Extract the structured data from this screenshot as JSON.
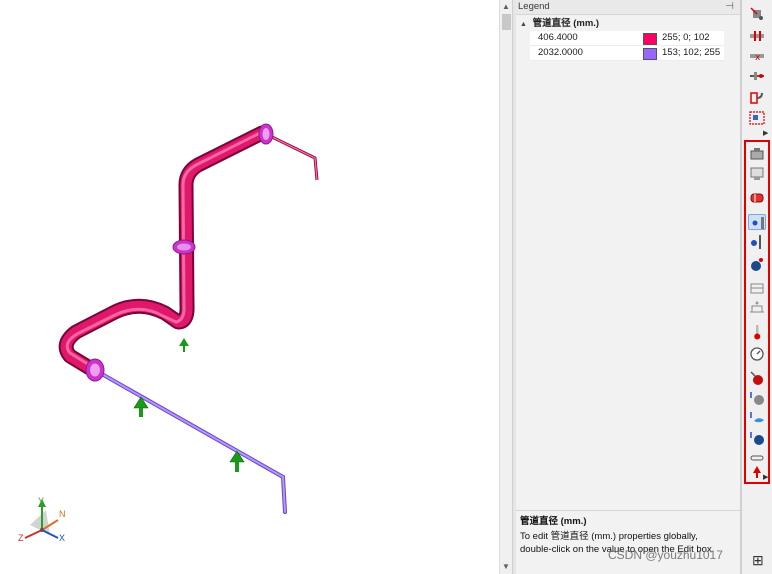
{
  "legend": {
    "panel_title": "Legend",
    "pin_icon": "pin-icon",
    "header": "管道直径 (mm.)",
    "rows": [
      {
        "value": "406.4000",
        "color": "#ff0066",
        "rgb_text": "255; 0; 102"
      },
      {
        "value": "2032.0000",
        "color": "#9966ff",
        "rgb_text": "153; 102; 255"
      }
    ],
    "description": {
      "title": "管道直径 (mm.)",
      "line1": "To edit 管道直径 (mm.) properties globally,",
      "line2": "double-click on the value to open the Edit box."
    }
  },
  "axes": {
    "y": "Y",
    "n": "N",
    "z": "Z",
    "x": "X"
  },
  "colors": {
    "pipe_large": "#e0186c",
    "pipe_small": "#9966ff",
    "restraint_arrow": "#1a9a1a",
    "flange": "#cc33cc",
    "highlight_box": "#e00000"
  },
  "toolbar": {
    "top_icons": [
      "anchor-icon",
      "guide-icon",
      "limit-stop-icon",
      "nozzle-icon",
      "bend-icon",
      "tee-icon"
    ],
    "group_icons": [
      "valve-icon",
      "reducer-icon",
      "expansion-joint-icon",
      "restraint-node-icon",
      "hanger-icon",
      "displacement-icon",
      "flange-icon",
      "insulation-icon",
      "temperature-icon",
      "pressure-icon",
      "force-icon",
      "weight-icon",
      "wind-icon",
      "seismic-icon",
      "spring-icon",
      "uniform-load-icon"
    ],
    "more_icon": "more-arrow-icon",
    "layout_icon": "grid-layout-icon"
  },
  "watermark": "CSDN @youzhu1017"
}
